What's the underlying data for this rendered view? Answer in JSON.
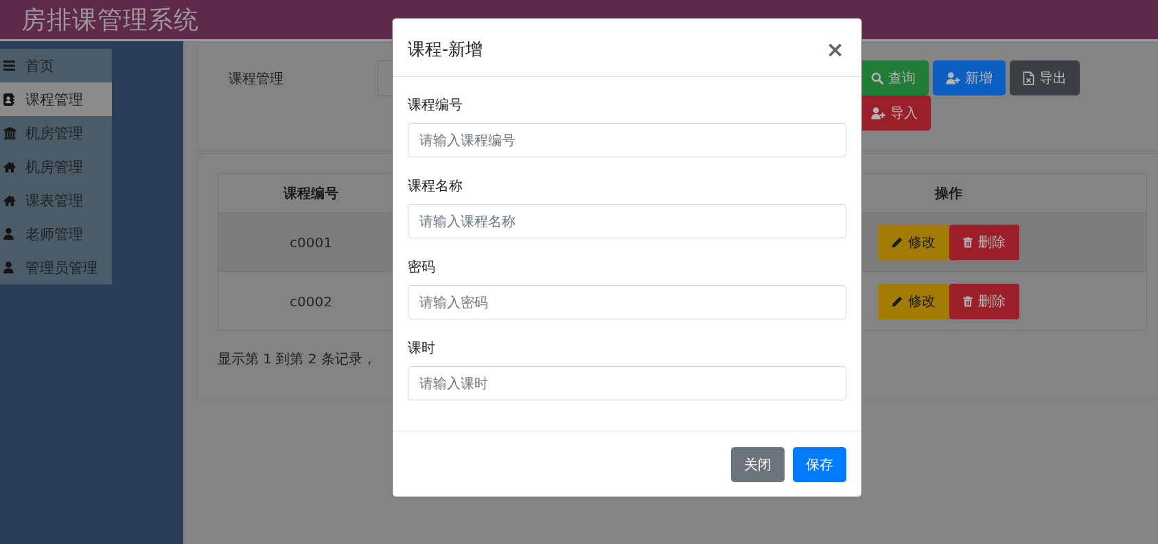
{
  "header": {
    "title": "房排课管理系统"
  },
  "sidebar": {
    "items": [
      {
        "label": "首页",
        "selected": false
      },
      {
        "label": "课程管理",
        "selected": true
      },
      {
        "label": "机房管理",
        "selected": false
      },
      {
        "label": "机房管理",
        "selected": false
      },
      {
        "label": "课表管理",
        "selected": false
      },
      {
        "label": "老师管理",
        "selected": false
      },
      {
        "label": "管理员管理",
        "selected": false
      }
    ]
  },
  "toolbar": {
    "label": "课程管理",
    "buttons": [
      {
        "kind": "search",
        "label": "查询"
      },
      {
        "kind": "add",
        "label": "新增"
      },
      {
        "kind": "export",
        "label": "导出"
      },
      {
        "kind": "import",
        "label": "导入"
      }
    ]
  },
  "table": {
    "columns": [
      "课程编号",
      "操作"
    ],
    "rows": [
      {
        "cells": [
          "c0001"
        ],
        "actions": [
          {
            "kind": "edit",
            "label": "修改"
          },
          {
            "kind": "delete",
            "label": "删除"
          }
        ]
      },
      {
        "cells": [
          "c0002"
        ],
        "actions": [
          {
            "kind": "edit",
            "label": "修改"
          },
          {
            "kind": "delete",
            "label": "删除"
          }
        ]
      }
    ],
    "summary": "显示第 1 到第 2 条记录，"
  },
  "dialog": {
    "title": "课程-新增",
    "close": "×",
    "fields": [
      {
        "label": "课程编号",
        "placeholder": "请输入课程编号"
      },
      {
        "label": "课程名称",
        "placeholder": "请输入课程名称"
      },
      {
        "label": "密码",
        "placeholder": "请输入密码"
      },
      {
        "label": "课时",
        "placeholder": "请输入课时"
      }
    ],
    "buttons": [
      {
        "kind": "cancel",
        "label": "关闭"
      },
      {
        "kind": "save",
        "label": "保存"
      }
    ]
  }
}
